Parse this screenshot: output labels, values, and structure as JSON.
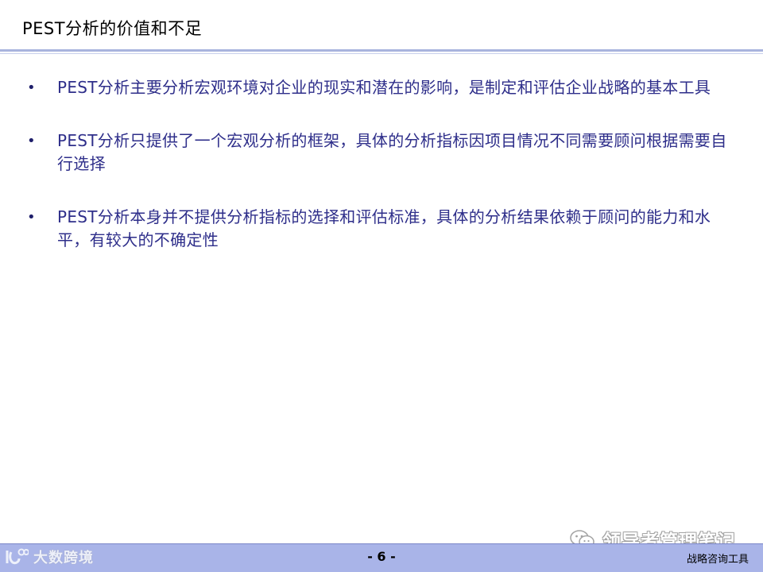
{
  "slide": {
    "title": "PEST分析的价值和不足"
  },
  "bullets": [
    {
      "marker": "•",
      "text": "PEST分析主要分析宏观环境对企业的现实和潜在的影响，是制定和评估企业战略的基本工具"
    },
    {
      "marker": "•",
      "text": "PEST分析只提供了一个宏观分析的框架，具体的分析指标因项目情况不同需要顾问根据需要自行选择"
    },
    {
      "marker": "•",
      "text": "PEST分析本身并不提供分析指标的选择和评估标准，具体的分析结果依赖于顾问的能力和水平，有较大的不确定性"
    }
  ],
  "footer": {
    "logo_text": "大数跨境",
    "logo_icon": "brand-logo-icon",
    "page_number": "- 6 -",
    "right_label": "战略咨询工具"
  },
  "watermark": {
    "icon": "wechat-icon",
    "text": "领导者管理笔记"
  },
  "colors": {
    "bullet_text": "#2e2e8a",
    "title_rule": "#a9b4de",
    "footer_bar": "#a9b4e8"
  }
}
